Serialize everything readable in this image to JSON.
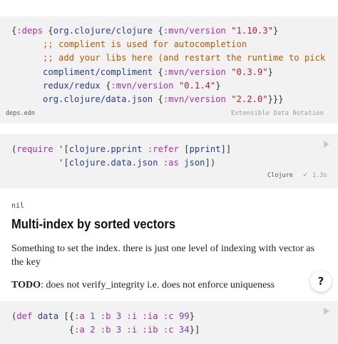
{
  "deps_cell": {
    "lines": [
      [
        [
          "c-par",
          "{"
        ],
        [
          "c-kw",
          ":deps"
        ],
        [
          "c-par",
          " {"
        ],
        [
          "c-sym",
          "org.clojure/clojure"
        ],
        [
          "c-par",
          " {"
        ],
        [
          "c-kw",
          ":mvn/version"
        ],
        [
          "c-par",
          " "
        ],
        [
          "c-str",
          "\"1.10.3\""
        ],
        [
          "c-par",
          "}"
        ]
      ],
      [
        [
          "c-par",
          "      "
        ],
        [
          "c-cm",
          ";; complient is used for autocompletion"
        ]
      ],
      [
        [
          "c-par",
          "      "
        ],
        [
          "c-cm",
          ";; add your libs here (and restart the runtime to pick"
        ]
      ],
      [
        [
          "c-par",
          "      "
        ],
        [
          "c-sym",
          "compliment/compliment"
        ],
        [
          "c-par",
          " {"
        ],
        [
          "c-kw",
          ":mvn/version"
        ],
        [
          "c-par",
          " "
        ],
        [
          "c-str",
          "\"0.3.9\""
        ],
        [
          "c-par",
          "}"
        ]
      ],
      [
        [
          "c-par",
          "      "
        ],
        [
          "c-sym",
          "redux/redux"
        ],
        [
          "c-par",
          " {"
        ],
        [
          "c-kw",
          ":mvn/version"
        ],
        [
          "c-par",
          " "
        ],
        [
          "c-str",
          "\"0.1.4\""
        ],
        [
          "c-par",
          "}"
        ]
      ],
      [
        [
          "c-par",
          "      "
        ],
        [
          "c-sym",
          "org.clojure/data.json"
        ],
        [
          "c-par",
          " {"
        ],
        [
          "c-kw",
          ":mvn/version"
        ],
        [
          "c-par",
          " "
        ],
        [
          "c-str",
          "\"2.2.0\""
        ],
        [
          "c-par",
          "}}}"
        ]
      ]
    ],
    "filename": "deps.edn",
    "format": "Extensible Data Notation"
  },
  "require_cell": {
    "lines": [
      [
        [
          "c-par",
          "("
        ],
        [
          "c-kw",
          "require"
        ],
        [
          "c-par",
          " '["
        ],
        [
          "c-sym",
          "clojure.pprint"
        ],
        [
          "c-par",
          " "
        ],
        [
          "c-kw",
          ":refer"
        ],
        [
          "c-par",
          " ["
        ],
        [
          "c-sym",
          "pprint"
        ],
        [
          "c-par",
          "]]"
        ]
      ],
      [
        [
          "c-par",
          "         '["
        ],
        [
          "c-sym",
          "clojure.data.json"
        ],
        [
          "c-par",
          " "
        ],
        [
          "c-kw",
          ":as"
        ],
        [
          "c-par",
          " "
        ],
        [
          "c-sym",
          "json"
        ],
        [
          "c-par",
          "])"
        ]
      ]
    ],
    "language": "Clojure",
    "status_check": "✓",
    "duration": "1.3s"
  },
  "output": {
    "text": "nil"
  },
  "section": {
    "heading": "Multi-index by sorted vectors",
    "paragraph": "Something to set the index. there is just one level of indexing with vector as the key",
    "todo_label": "TODO",
    "todo_text": ": does not verify_integrity i.e. does not enforce uniqueness"
  },
  "def_cell": {
    "lines": [
      [
        [
          "c-par",
          "("
        ],
        [
          "c-kw",
          "def"
        ],
        [
          "c-par",
          " "
        ],
        [
          "c-sym",
          "data"
        ],
        [
          "c-par",
          " [{"
        ],
        [
          "c-kw",
          ":a"
        ],
        [
          "c-par",
          " "
        ],
        [
          "c-num",
          "1"
        ],
        [
          "c-par",
          " "
        ],
        [
          "c-kw",
          ":b"
        ],
        [
          "c-par",
          " "
        ],
        [
          "c-num",
          "3"
        ],
        [
          "c-par",
          " "
        ],
        [
          "c-kw",
          ":i"
        ],
        [
          "c-par",
          " "
        ],
        [
          "c-kw",
          ":ia"
        ],
        [
          "c-par",
          " "
        ],
        [
          "c-kw",
          ":c"
        ],
        [
          "c-par",
          " "
        ],
        [
          "c-num",
          "99"
        ],
        [
          "c-par",
          "}"
        ]
      ],
      [
        [
          "c-par",
          "           {"
        ],
        [
          "c-kw",
          ":a"
        ],
        [
          "c-par",
          " "
        ],
        [
          "c-num",
          "2"
        ],
        [
          "c-par",
          " "
        ],
        [
          "c-kw",
          ":b"
        ],
        [
          "c-par",
          " "
        ],
        [
          "c-num",
          "3"
        ],
        [
          "c-par",
          " "
        ],
        [
          "c-kw",
          ":i"
        ],
        [
          "c-par",
          " "
        ],
        [
          "c-kw",
          ":ib"
        ],
        [
          "c-par",
          " "
        ],
        [
          "c-kw",
          ":c"
        ],
        [
          "c-par",
          " "
        ],
        [
          "c-num",
          "34"
        ],
        [
          "c-par",
          "}]"
        ]
      ]
    ]
  },
  "help": {
    "label": "?"
  },
  "icons": {
    "run": "play-icon",
    "success": "check-icon"
  }
}
